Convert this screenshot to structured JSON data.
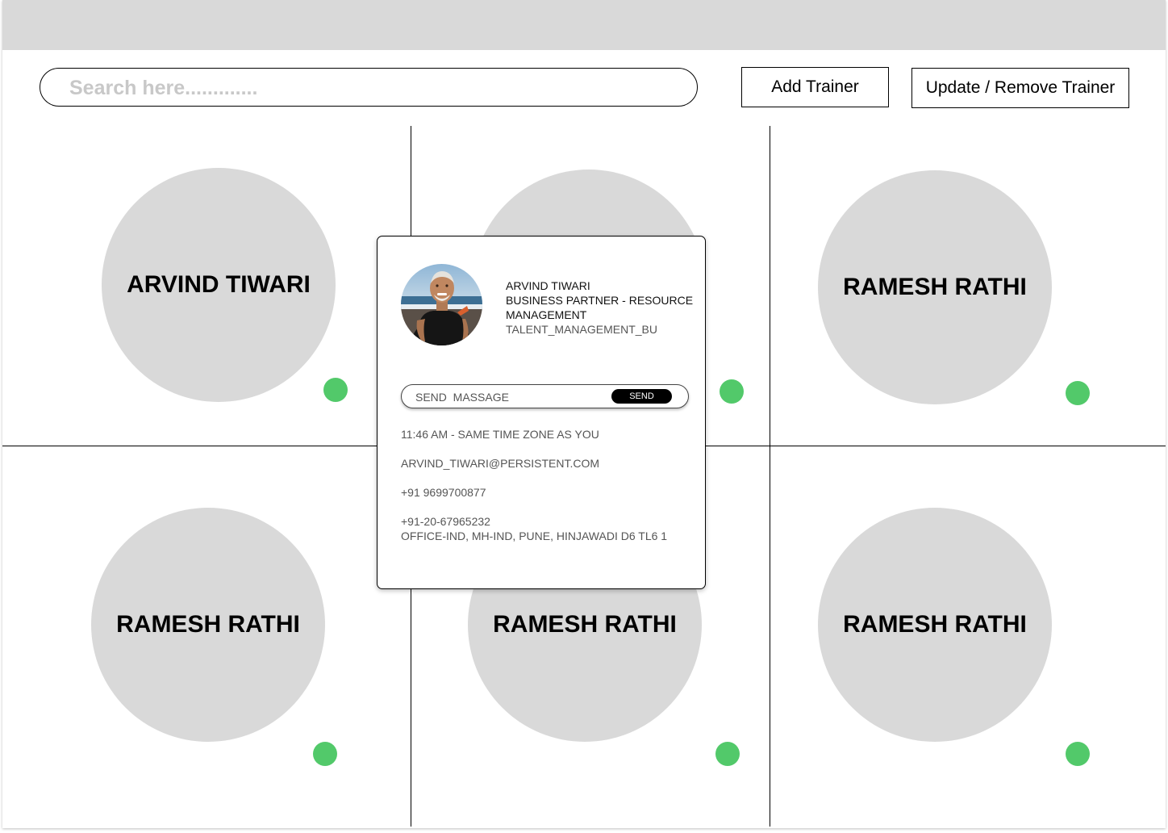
{
  "colors": {
    "status_online": "#52c96a",
    "avatar_bg": "#d9d9d9",
    "top_bar": "#d9d9d9"
  },
  "search": {
    "placeholder": "Search here............."
  },
  "toolbar": {
    "add_label": "Add Trainer",
    "update_label": "Update / Remove Trainer"
  },
  "trainers": [
    {
      "name": "ARVIND TIWARI",
      "status": "online"
    },
    {
      "name": "",
      "status": "online"
    },
    {
      "name": "RAMESH RATHI",
      "status": "online"
    },
    {
      "name": "RAMESH RATHI",
      "status": "online"
    },
    {
      "name": "RAMESH RATHI",
      "status": "online"
    },
    {
      "name": "RAMESH RATHI",
      "status": "online"
    }
  ],
  "profile_card": {
    "photo_icon": "person-photo",
    "name": "ARVIND TIWARI",
    "role": "BUSINESS PARTNER - RESOURCE MANAGEMENT",
    "unit": "TALENT_MANAGEMENT_BU",
    "message_placeholder": "SEND  MASSAGE",
    "send_label": "SEND",
    "local_time": "11:46 AM - SAME TIME ZONE AS YOU",
    "email": "ARVIND_TIWARI@PERSISTENT.COM",
    "mobile": "+91 9699700877",
    "office_phone": "+91-20-67965232",
    "office_location": "OFFICE-IND, MH-IND, PUNE, HINJAWADI D6 TL6 1"
  }
}
